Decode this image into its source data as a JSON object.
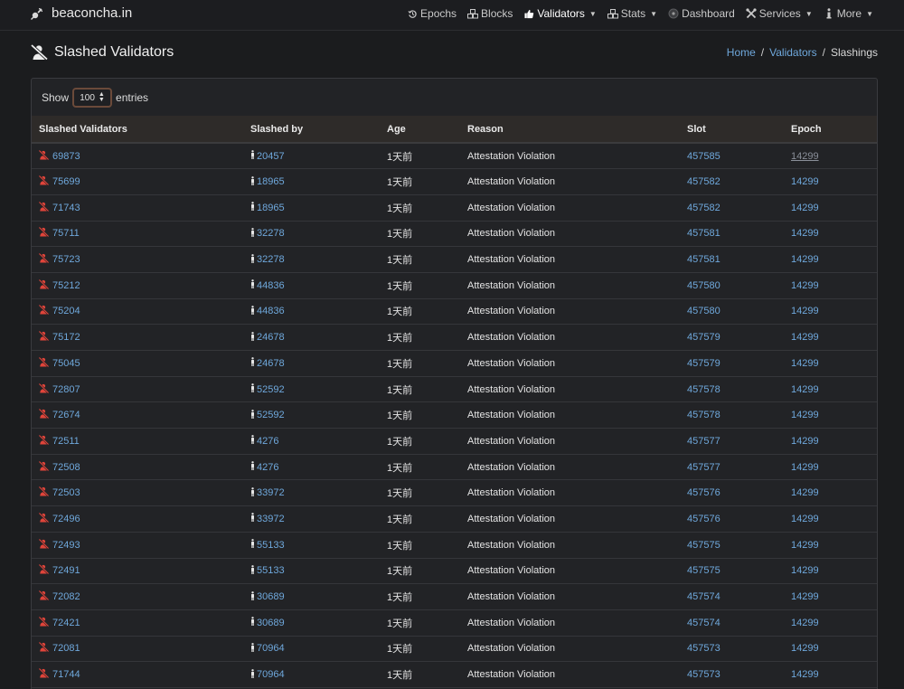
{
  "brand": {
    "name": "beaconcha.in",
    "logo_icon": "satellite-icon"
  },
  "nav": [
    {
      "label": "Epochs",
      "icon": "history-icon",
      "dropdown": false
    },
    {
      "label": "Blocks",
      "icon": "cubes-icon",
      "dropdown": false
    },
    {
      "label": "Validators",
      "icon": "thumbs-up-icon",
      "dropdown": true,
      "active": true
    },
    {
      "label": "Stats",
      "icon": "cubes-icon",
      "dropdown": true
    },
    {
      "label": "Dashboard",
      "icon": "dot-circle-icon",
      "dropdown": false
    },
    {
      "label": "Services",
      "icon": "tools-icon",
      "dropdown": true
    },
    {
      "label": "More",
      "icon": "info-icon",
      "dropdown": true
    }
  ],
  "page": {
    "title": "Slashed Validators",
    "title_icon": "user-slash-icon"
  },
  "breadcrumb": {
    "home": "Home",
    "validators": "Validators",
    "current": "Slashings",
    "separator": "/"
  },
  "table_controls": {
    "show_label": "Show",
    "length_value": "100",
    "entries_label": "entries"
  },
  "columns": [
    "Slashed Validators",
    "Slashed by",
    "Age",
    "Reason",
    "Slot",
    "Epoch"
  ],
  "rows": [
    {
      "validator": "69873",
      "slashed_by": "20457",
      "age": "1天前",
      "reason": "Attestation Violation",
      "slot": "457585",
      "epoch": "14299"
    },
    {
      "validator": "75699",
      "slashed_by": "18965",
      "age": "1天前",
      "reason": "Attestation Violation",
      "slot": "457582",
      "epoch": "14299"
    },
    {
      "validator": "71743",
      "slashed_by": "18965",
      "age": "1天前",
      "reason": "Attestation Violation",
      "slot": "457582",
      "epoch": "14299"
    },
    {
      "validator": "75711",
      "slashed_by": "32278",
      "age": "1天前",
      "reason": "Attestation Violation",
      "slot": "457581",
      "epoch": "14299"
    },
    {
      "validator": "75723",
      "slashed_by": "32278",
      "age": "1天前",
      "reason": "Attestation Violation",
      "slot": "457581",
      "epoch": "14299"
    },
    {
      "validator": "75212",
      "slashed_by": "44836",
      "age": "1天前",
      "reason": "Attestation Violation",
      "slot": "457580",
      "epoch": "14299"
    },
    {
      "validator": "75204",
      "slashed_by": "44836",
      "age": "1天前",
      "reason": "Attestation Violation",
      "slot": "457580",
      "epoch": "14299"
    },
    {
      "validator": "75172",
      "slashed_by": "24678",
      "age": "1天前",
      "reason": "Attestation Violation",
      "slot": "457579",
      "epoch": "14299"
    },
    {
      "validator": "75045",
      "slashed_by": "24678",
      "age": "1天前",
      "reason": "Attestation Violation",
      "slot": "457579",
      "epoch": "14299"
    },
    {
      "validator": "72807",
      "slashed_by": "52592",
      "age": "1天前",
      "reason": "Attestation Violation",
      "slot": "457578",
      "epoch": "14299"
    },
    {
      "validator": "72674",
      "slashed_by": "52592",
      "age": "1天前",
      "reason": "Attestation Violation",
      "slot": "457578",
      "epoch": "14299"
    },
    {
      "validator": "72511",
      "slashed_by": "4276",
      "age": "1天前",
      "reason": "Attestation Violation",
      "slot": "457577",
      "epoch": "14299"
    },
    {
      "validator": "72508",
      "slashed_by": "4276",
      "age": "1天前",
      "reason": "Attestation Violation",
      "slot": "457577",
      "epoch": "14299"
    },
    {
      "validator": "72503",
      "slashed_by": "33972",
      "age": "1天前",
      "reason": "Attestation Violation",
      "slot": "457576",
      "epoch": "14299"
    },
    {
      "validator": "72496",
      "slashed_by": "33972",
      "age": "1天前",
      "reason": "Attestation Violation",
      "slot": "457576",
      "epoch": "14299"
    },
    {
      "validator": "72493",
      "slashed_by": "55133",
      "age": "1天前",
      "reason": "Attestation Violation",
      "slot": "457575",
      "epoch": "14299"
    },
    {
      "validator": "72491",
      "slashed_by": "55133",
      "age": "1天前",
      "reason": "Attestation Violation",
      "slot": "457575",
      "epoch": "14299"
    },
    {
      "validator": "72082",
      "slashed_by": "30689",
      "age": "1天前",
      "reason": "Attestation Violation",
      "slot": "457574",
      "epoch": "14299"
    },
    {
      "validator": "72421",
      "slashed_by": "30689",
      "age": "1天前",
      "reason": "Attestation Violation",
      "slot": "457574",
      "epoch": "14299"
    },
    {
      "validator": "72081",
      "slashed_by": "70964",
      "age": "1天前",
      "reason": "Attestation Violation",
      "slot": "457573",
      "epoch": "14299"
    },
    {
      "validator": "71744",
      "slashed_by": "70964",
      "age": "1天前",
      "reason": "Attestation Violation",
      "slot": "457573",
      "epoch": "14299"
    }
  ],
  "colors": {
    "background": "#1b1c1e",
    "link": "#6fa8dc",
    "slash_icon": "#e0443a",
    "header_row": "#2e2b29"
  }
}
